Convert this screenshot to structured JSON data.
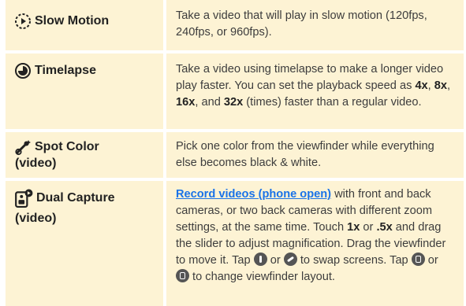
{
  "rows": [
    {
      "title": "Slow Motion",
      "icon": "slow-motion-icon",
      "desc": "Take a video that will play in slow motion (120fps, 240fps, or 960fps)."
    },
    {
      "title": "Timelapse",
      "icon": "timelapse-icon",
      "desc_a": "Take a video using timelapse to make a longer video play faster. You can set the playback speed as ",
      "s1": "4x",
      "c1": ", ",
      "s2": "8x",
      "c2": ", ",
      "s3": "16x",
      "c3": ", and ",
      "s4": "32x",
      "desc_b": " (times) faster than a regular video."
    },
    {
      "title_1": "Spot Color",
      "title_2": "(video)",
      "icon": "spot-color-icon",
      "desc": "Pick one color from the viewfinder while everything else becomes black & white."
    },
    {
      "title_1": "Dual Capture",
      "title_2": "(video)",
      "icon": "dual-capture-icon",
      "link": "Record videos (phone open)",
      "p1": " with front and back cameras, or two back cameras with different zoom settings, at the same time. Touch ",
      "b1": "1x",
      "p2": " or ",
      "b2": ".5x",
      "p3": " and drag the slider to adjust magnification. Drag the viewfinder to move it. Tap ",
      "p4": " or ",
      "p5": " to swap screens. Tap ",
      "p6": " or ",
      "p7": " to change viewfinder layout."
    }
  ],
  "colors": {
    "row_bg": "#fdf3d4",
    "link": "#1a73e8"
  }
}
